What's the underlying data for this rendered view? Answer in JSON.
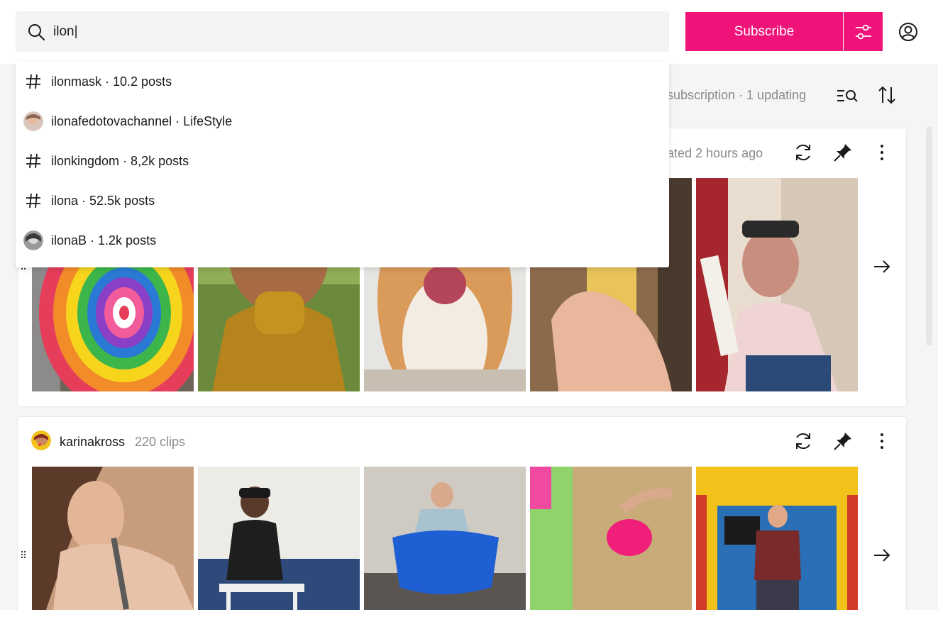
{
  "search": {
    "value": "ilon|"
  },
  "header": {
    "subscribe_label": "Subscribe"
  },
  "subheader": {
    "status": "subscription · 1 updating"
  },
  "suggestions": [
    {
      "type": "hashtag",
      "text": "ilonmask · 10.2 posts"
    },
    {
      "type": "channel",
      "text": "ilonafedotovachannel · LifeStyle"
    },
    {
      "type": "hashtag",
      "text": "ilonkingdom · 8,2k posts"
    },
    {
      "type": "hashtag",
      "text": "ilona · 52.5k posts"
    },
    {
      "type": "channel",
      "text": "ilonaB · 1.2k posts"
    }
  ],
  "cards": [
    {
      "updated": "ated 2 hours ago"
    },
    {
      "name": "karinakross",
      "count": "220 clips"
    }
  ],
  "colors": {
    "accent": "#f0147a",
    "muted_text": "#8a8a8a"
  },
  "icons": [
    "search-icon",
    "filter-sliders-icon",
    "account-icon",
    "list-search-icon",
    "sort-icon",
    "refresh-icon",
    "pin-icon",
    "more-icon",
    "arrow-right-icon",
    "hashtag-icon",
    "drag-handle-icon"
  ]
}
